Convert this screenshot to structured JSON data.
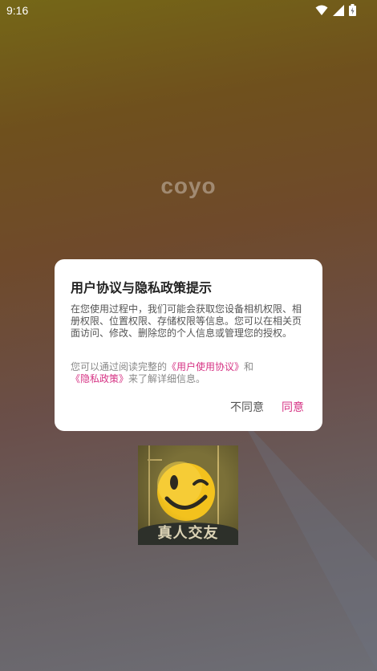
{
  "status_bar": {
    "time": "9:16",
    "icons": [
      "wifi-icon",
      "signal-icon",
      "battery-icon"
    ]
  },
  "app": {
    "name": "coyo"
  },
  "promo": {
    "caption": "真人交友",
    "icon": "winking-smiley-icon"
  },
  "dialog": {
    "title": "用户协议与隐私政策提示",
    "body": "在您使用过程中，我们可能会获取您设备相机权限、相册权限、位置权限、存储权限等信息。您可以在相关页面访问、修改、删除您的个人信息或管理您的授权。",
    "note_prefix": "您可以通过阅读完整的",
    "user_agreement_link": "《用户使用协议》",
    "note_and": "和",
    "privacy_policy_link": "《隐私政策》",
    "note_suffix": "来了解详细信息。",
    "disagree_label": "不同意",
    "agree_label": "同意"
  },
  "colors": {
    "accent": "#d63384",
    "dialog_background": "#ffffff",
    "title_text": "#222222"
  }
}
